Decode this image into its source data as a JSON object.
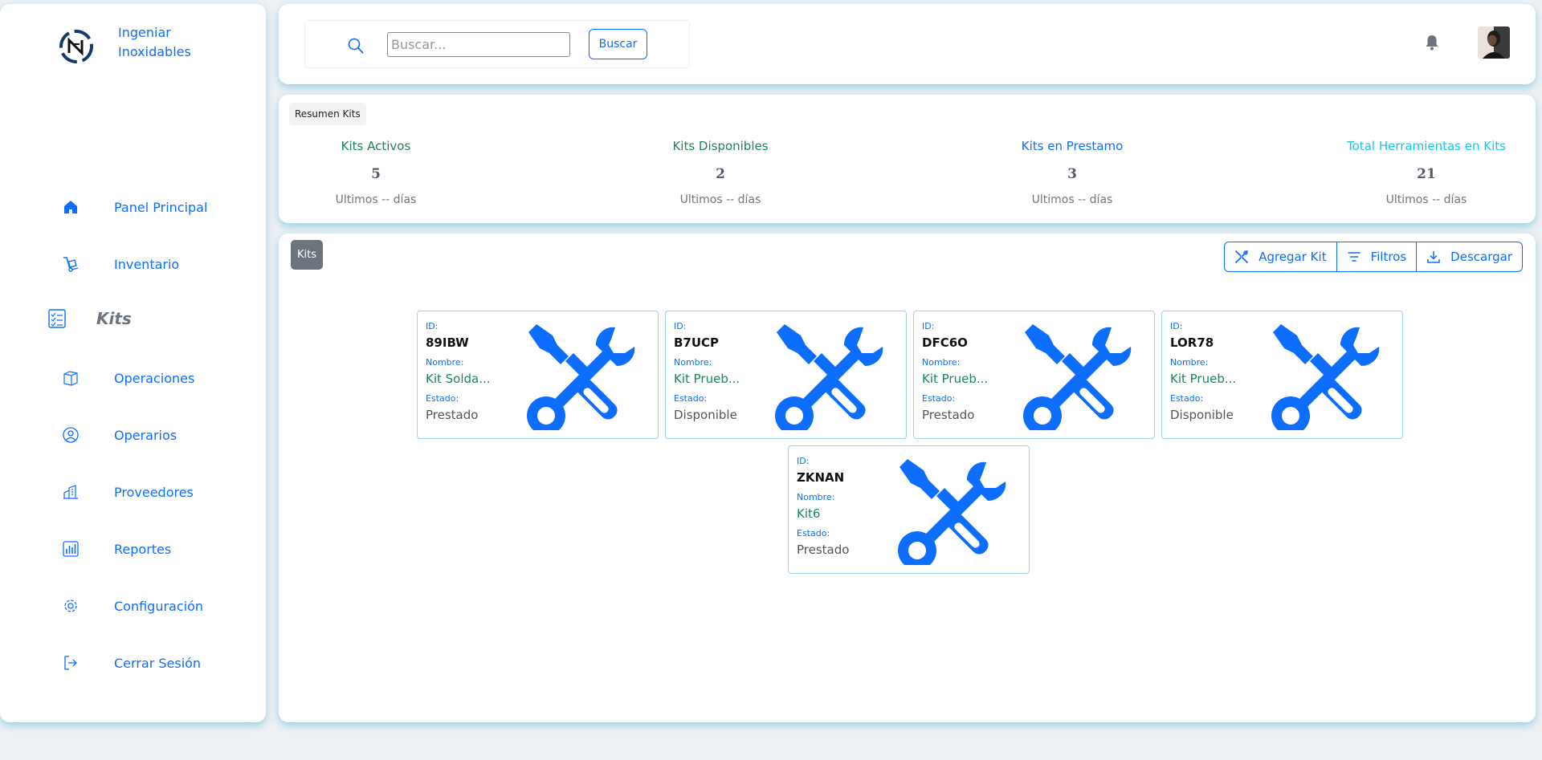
{
  "brand": {
    "name": "Ingeniar Inoxidables"
  },
  "sidebar": {
    "items": [
      {
        "label": "Panel Principal",
        "icon": "home-icon"
      },
      {
        "label": "Inventario",
        "icon": "dolly-icon"
      },
      {
        "label": "Kits",
        "icon": "checklist-icon",
        "active": true
      },
      {
        "label": "Operaciones",
        "icon": "box-icon"
      },
      {
        "label": "Operarios",
        "icon": "user-circle-icon"
      },
      {
        "label": "Proveedores",
        "icon": "building-icon"
      },
      {
        "label": "Reportes",
        "icon": "bar-chart-icon"
      },
      {
        "label": "Configuración",
        "icon": "gear-icon"
      },
      {
        "label": "Cerrar Sesión",
        "icon": "logout-icon"
      }
    ]
  },
  "header": {
    "search_placeholder": "Buscar...",
    "search_button": "Buscar"
  },
  "summary": {
    "tab_label": "Resumen Kits",
    "stats": [
      {
        "title": "Kits Activos",
        "value": "5",
        "sub": "Ultimos -- días",
        "color": "#198754"
      },
      {
        "title": "Kits Disponibles",
        "value": "2",
        "sub": "Ultimos -- días",
        "color": "#198754"
      },
      {
        "title": "Kits en Prestamo",
        "value": "3",
        "sub": "Ultimos -- días",
        "color": "#0d6efd"
      },
      {
        "title": "Total Herramientas en Kits",
        "value": "21",
        "sub": "Ultimos -- días",
        "color": "#0dcaf0"
      }
    ]
  },
  "kits": {
    "tag": "Kits",
    "actions": [
      {
        "label": "Agregar Kit",
        "icon": "tools-icon"
      },
      {
        "label": "Filtros",
        "icon": "filter-icon"
      },
      {
        "label": "Descargar",
        "icon": "download-icon"
      }
    ],
    "field_labels": {
      "id": "ID:",
      "name": "Nombre:",
      "state": "Estado:"
    },
    "cards": [
      {
        "id": "89IBW",
        "name": "Kit Solda...",
        "state": "Prestado"
      },
      {
        "id": "B7UCP",
        "name": "Kit Prueb...",
        "state": "Disponible"
      },
      {
        "id": "DFC6O",
        "name": "Kit Prueb...",
        "state": "Prestado"
      },
      {
        "id": "LOR78",
        "name": "Kit Prueb...",
        "state": "Disponible"
      },
      {
        "id": "ZKNAN",
        "name": "Kit6",
        "state": "Prestado"
      }
    ]
  },
  "colors": {
    "accent": "#0d6efd",
    "success": "#198754",
    "info": "#0dcaf0",
    "muted": "#6c757d"
  }
}
